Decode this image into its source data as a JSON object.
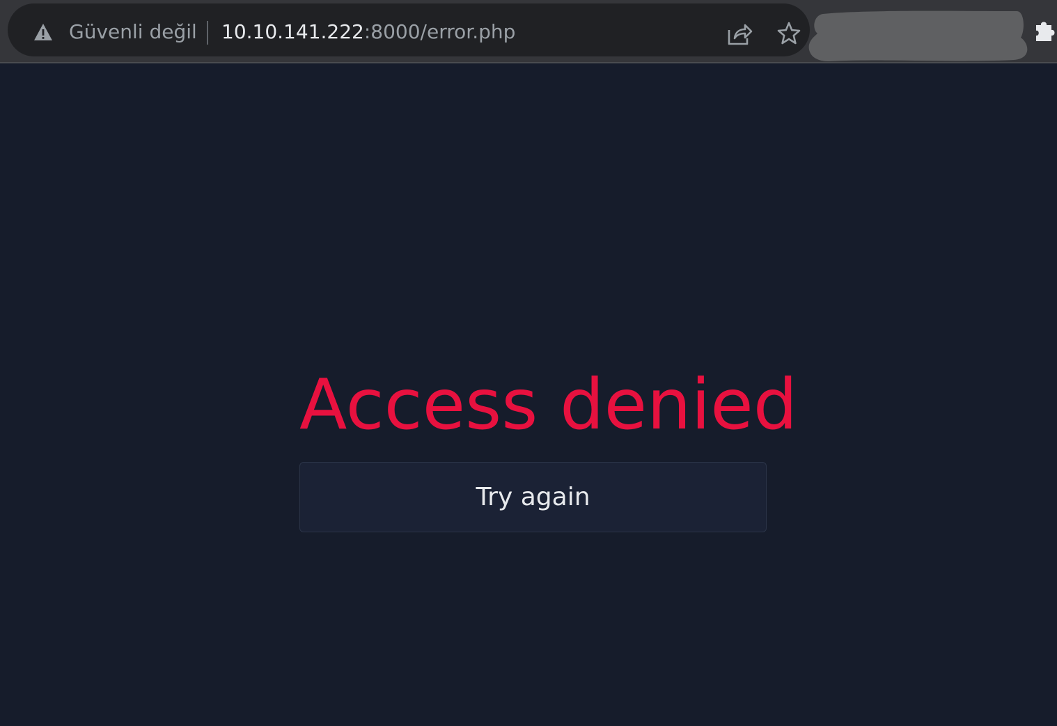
{
  "browser": {
    "security_label": "Güvenli değil",
    "url_host": "10.10.141.222",
    "url_rest": ":8000/error.php",
    "icons": {
      "security": "warning-triangle-icon",
      "share": "share-icon",
      "bookmark": "star-icon",
      "extensions": "puzzle-icon"
    }
  },
  "page": {
    "headline": "Access denied",
    "retry_label": "Try again"
  },
  "colors": {
    "background": "#161c2b",
    "headline": "#e8113f",
    "button_bg": "#1b2235",
    "toolbar": "#35363a",
    "omnibox": "#202124"
  }
}
